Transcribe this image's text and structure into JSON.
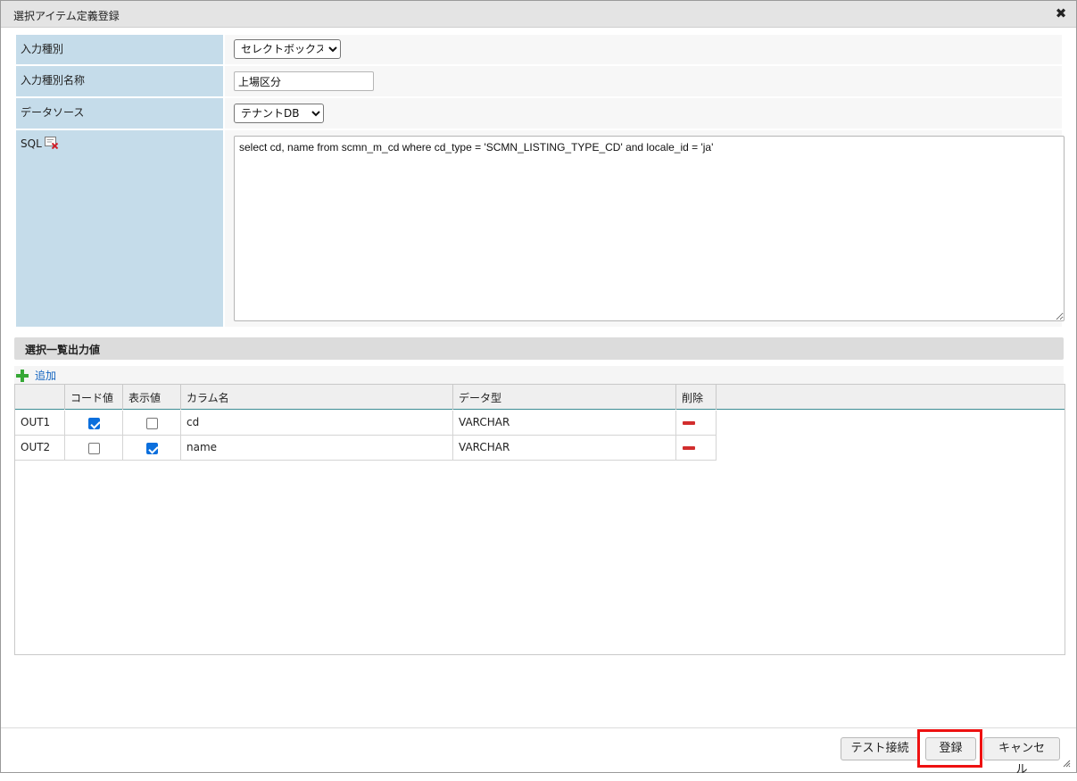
{
  "dialog": {
    "title": "選択アイテム定義登録",
    "close_symbol": "✖"
  },
  "form": {
    "input_type": {
      "label": "入力種別",
      "value": "セレクトボックス"
    },
    "input_type_name": {
      "label": "入力種別名称",
      "value": "上場区分"
    },
    "data_source": {
      "label": "データソース",
      "value": "テナントDB"
    },
    "sql": {
      "label": "SQL",
      "value": "select cd, name from scmn_m_cd where cd_type = 'SCMN_LISTING_TYPE_CD' and locale_id = 'ja'"
    }
  },
  "output_section": {
    "title": "選択一覧出力値",
    "add_label": "追加",
    "columns": [
      "",
      "コード値",
      "表示値",
      "カラム名",
      "データ型",
      "削除"
    ],
    "rows": [
      {
        "id": "OUT1",
        "code_value": true,
        "display_value": false,
        "column_name": "cd",
        "data_type": "VARCHAR"
      },
      {
        "id": "OUT2",
        "code_value": false,
        "display_value": true,
        "column_name": "name",
        "data_type": "VARCHAR"
      }
    ]
  },
  "footer": {
    "test_connection": "テスト接続",
    "register": "登録",
    "cancel": "キャンセル"
  },
  "colors": {
    "label_bg": "#c5dcea",
    "highlight": "#ee1111",
    "checkbox_on": "#0b6fdd",
    "add_icon": "#36a836",
    "delete_icon": "#d22d2d"
  }
}
